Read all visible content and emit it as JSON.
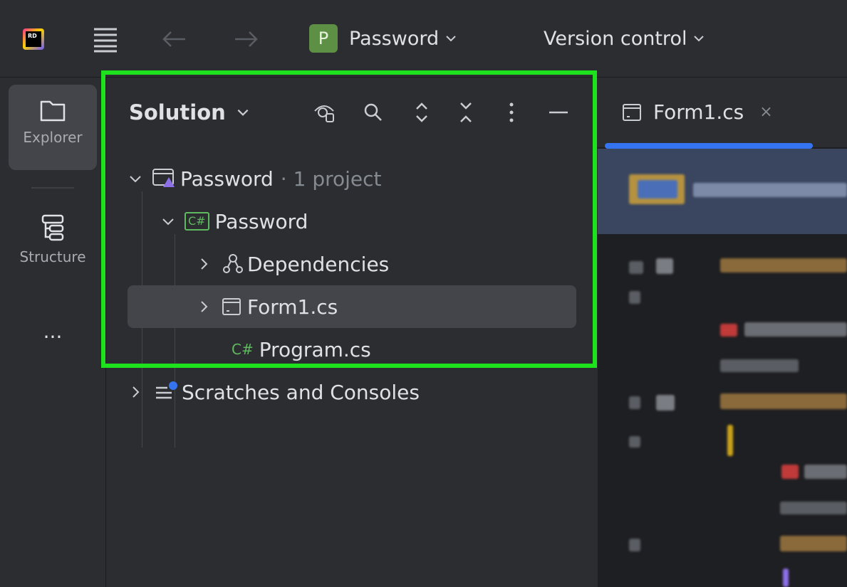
{
  "titlebar": {
    "logo_text": "RD",
    "project_badge": "P",
    "project_name": "Password",
    "vcs_label": "Version control"
  },
  "stripe": {
    "explorer_label": "Explorer",
    "structure_label": "Structure",
    "more_label": "..."
  },
  "panel": {
    "title": "Solution",
    "tree": [
      {
        "label": "Password",
        "suffix": "· 1 project"
      },
      {
        "label": "Password"
      },
      {
        "label": "Dependencies"
      },
      {
        "label": "Form1.cs"
      },
      {
        "label": "Program.cs",
        "icon_text": "C#"
      },
      {
        "label": "Scratches and Consoles"
      }
    ],
    "csproj_icon_text": "C#"
  },
  "editor": {
    "tab_label": "Form1.cs",
    "tab_close": "×"
  },
  "colors": {
    "highlight": "#1fe21f",
    "accent": "#3574f0",
    "badge": "#5d8f44",
    "csharp": "#5fb95f"
  }
}
